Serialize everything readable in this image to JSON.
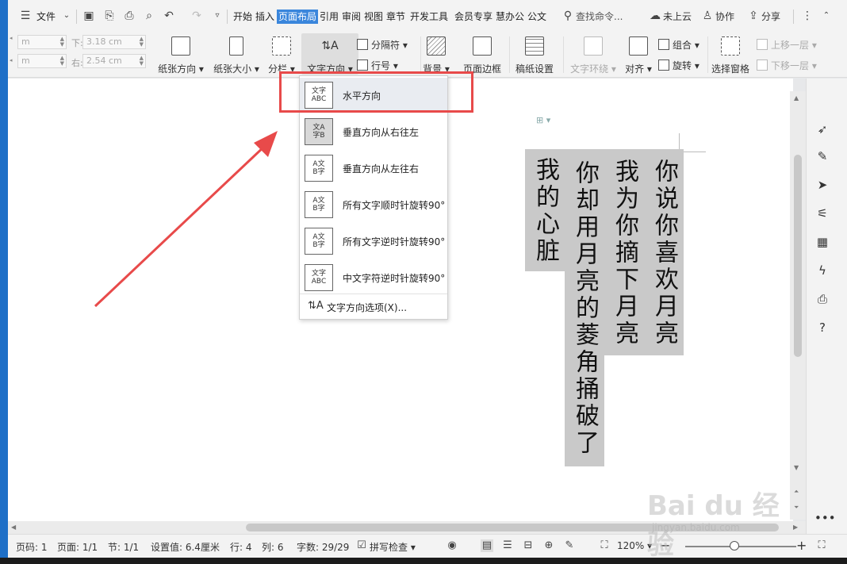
{
  "menubar": {
    "file": "文件",
    "tabs": [
      "开始",
      "插入",
      "页面布局",
      "引用",
      "审阅",
      "视图",
      "章节",
      "开发工具",
      "会员专享",
      "慧办公",
      "公文"
    ],
    "active_tab": "页面布局",
    "search": "查找命令...",
    "cloud": "未上云",
    "collab": "协作",
    "share": "分享"
  },
  "ribbon": {
    "margins": {
      "top_value": "m",
      "bottom_label": "下:",
      "bottom_value": "3.18 cm",
      "left_value": "m",
      "right_label": "右:",
      "right_value": "2.54 cm"
    },
    "orientation": "纸张方向",
    "size": "纸张大小",
    "columns": "分栏",
    "text_direction": "文字方向",
    "breaks": "分隔符",
    "line_numbers": "行号",
    "background": "背景",
    "page_border": "页面边框",
    "manuscript": "稿纸设置",
    "text_wrap": "文字环绕",
    "align": "对齐",
    "group": "组合",
    "rotate": "旋转",
    "selection_pane": "选择窗格",
    "bring_forward": "上移一层",
    "send_backward": "下移一层"
  },
  "dropdown": {
    "items": [
      {
        "label": "水平方向",
        "icon": "文字\nABC"
      },
      {
        "label": "垂直方向从右往左",
        "icon": "文字\nABC"
      },
      {
        "label": "垂直方向从左往右",
        "icon": "文字\nABC"
      },
      {
        "label": "所有文字顺时针旋转90°",
        "icon": "ABC\n文字"
      },
      {
        "label": "所有文字逆时针旋转90°",
        "icon": "ABC\n文字"
      },
      {
        "label": "中文字符逆时针旋转90°",
        "icon": "文字\nABC"
      }
    ],
    "options": "文字方向选项(X)..."
  },
  "document": {
    "columns": [
      "你说你喜欢月亮",
      "我为你摘下月亮",
      "你却用月亮的菱角捅破了",
      "我的心脏"
    ]
  },
  "statusbar": {
    "page_num": "页码: 1",
    "pages": "页面: 1/1",
    "section": "节: 1/1",
    "setting": "设置值: 6.4厘米",
    "row": "行: 4",
    "col": "列: 6",
    "words": "字数: 29/29",
    "spell": "拼写检查",
    "zoom": "120%"
  },
  "watermark": {
    "brand": "Bai du 经验",
    "url": "jingyan.baidu.com"
  },
  "colors": {
    "accent": "#3a86dc",
    "highlight": "#e84a4a",
    "text_shading": "#c9c9c9"
  }
}
